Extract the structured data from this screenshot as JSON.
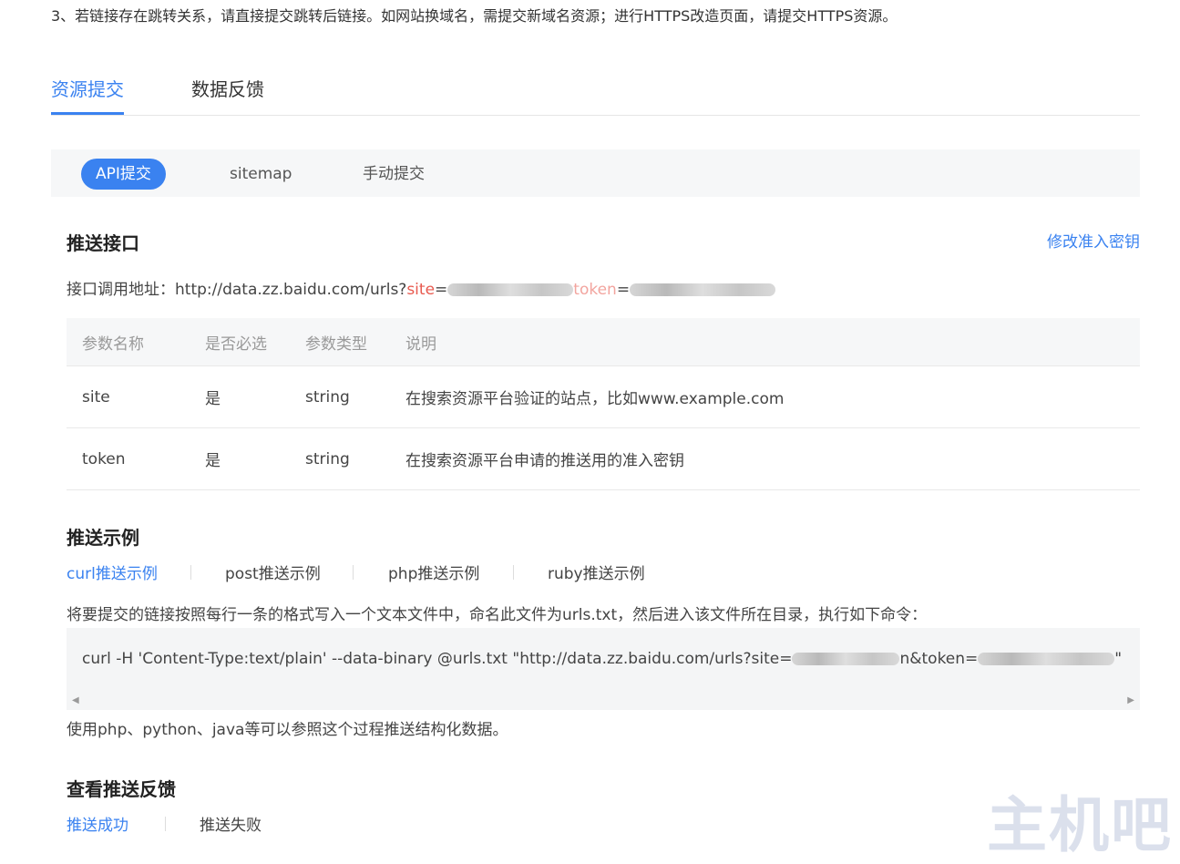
{
  "note": "3、若链接存在跳转关系，请直接提交跳转后链接。如网站换域名，需提交新域名资源；进行HTTPS改造页面，请提交HTTPS资源。",
  "main_tabs": [
    {
      "label": "资源提交",
      "active": true
    },
    {
      "label": "数据反馈",
      "active": false
    }
  ],
  "sub_tabs": [
    {
      "label": "API提交",
      "active": true
    },
    {
      "label": "sitemap",
      "active": false
    },
    {
      "label": "手动提交",
      "active": false
    }
  ],
  "push_api": {
    "title": "推送接口",
    "edit_key_link": "修改准入密钥",
    "address_label": "接口调用地址：",
    "address_prefix": "http://data.zz.baidu.com/urls?",
    "site_param": "site",
    "eq1": "=",
    "token_param": "token",
    "eq2": "="
  },
  "param_table": {
    "headers": [
      "参数名称",
      "是否必选",
      "参数类型",
      "说明"
    ],
    "rows": [
      [
        "site",
        "是",
        "string",
        "在搜索资源平台验证的站点，比如www.example.com"
      ],
      [
        "token",
        "是",
        "string",
        "在搜索资源平台申请的推送用的准入密钥"
      ]
    ]
  },
  "example": {
    "title": "推送示例",
    "tabs": [
      {
        "label": "curl推送示例",
        "active": true
      },
      {
        "label": "post推送示例",
        "active": false
      },
      {
        "label": "php推送示例",
        "active": false
      },
      {
        "label": "ruby推送示例",
        "active": false
      }
    ],
    "instruction": "将要提交的链接按照每行一条的格式写入一个文本文件中，命名此文件为urls.txt，然后进入该文件所在目录，执行如下命令：",
    "code_part1": "curl -H 'Content-Type:text/plain' --data-binary @urls.txt \"http://data.zz.baidu.com/urls?site=",
    "code_part2": "n&token=",
    "code_part3": "\"",
    "footer": "使用php、python、java等可以参照这个过程推送结构化数据。"
  },
  "feedback": {
    "title": "查看推送反馈",
    "tabs": [
      {
        "label": "推送成功",
        "active": true
      },
      {
        "label": "推送失败",
        "active": false
      }
    ]
  },
  "watermark": "主机吧",
  "colors": {
    "accent": "#3a82f0",
    "param_red": "#e85a4f"
  }
}
